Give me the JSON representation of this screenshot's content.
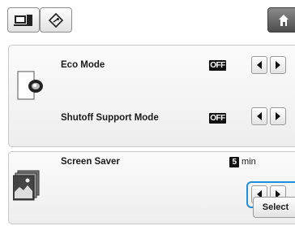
{
  "toolbar": {
    "buttons": [
      {
        "icon": "embroidery-machine-icon"
      },
      {
        "icon": "settings-diamond-icon"
      },
      {
        "icon": "home-icon"
      }
    ]
  },
  "settings": {
    "eco_mode": {
      "label": "Eco Mode",
      "value": "OFF"
    },
    "shutoff_support_mode": {
      "label": "Shutoff Support Mode",
      "value": "OFF"
    },
    "screen_saver": {
      "label": "Screen Saver",
      "value": "5",
      "unit": "min",
      "select_label": "Select"
    }
  },
  "colors": {
    "highlight": "#1e8fe0",
    "home_button": "#5a5a5a"
  }
}
